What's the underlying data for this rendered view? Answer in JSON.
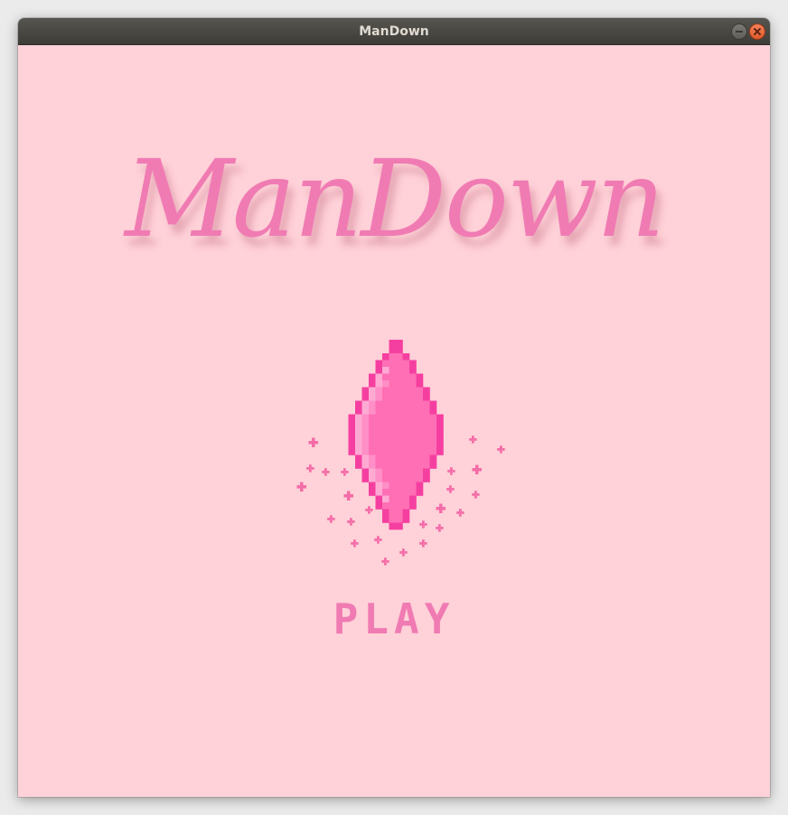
{
  "window": {
    "title": "ManDown",
    "minimize_icon": "minimize-icon",
    "close_icon": "close-icon"
  },
  "menu": {
    "logo": "ManDown",
    "play_label": "PLAY",
    "gem_icon": "gem-icon"
  },
  "colors": {
    "background": "#ffd1d8",
    "accent": "#f07bb3",
    "gem_base": "#ff6fb5",
    "gem_dark": "#f53fa0",
    "gem_light": "#ffaad3",
    "sparkle": "#f46ca8"
  }
}
